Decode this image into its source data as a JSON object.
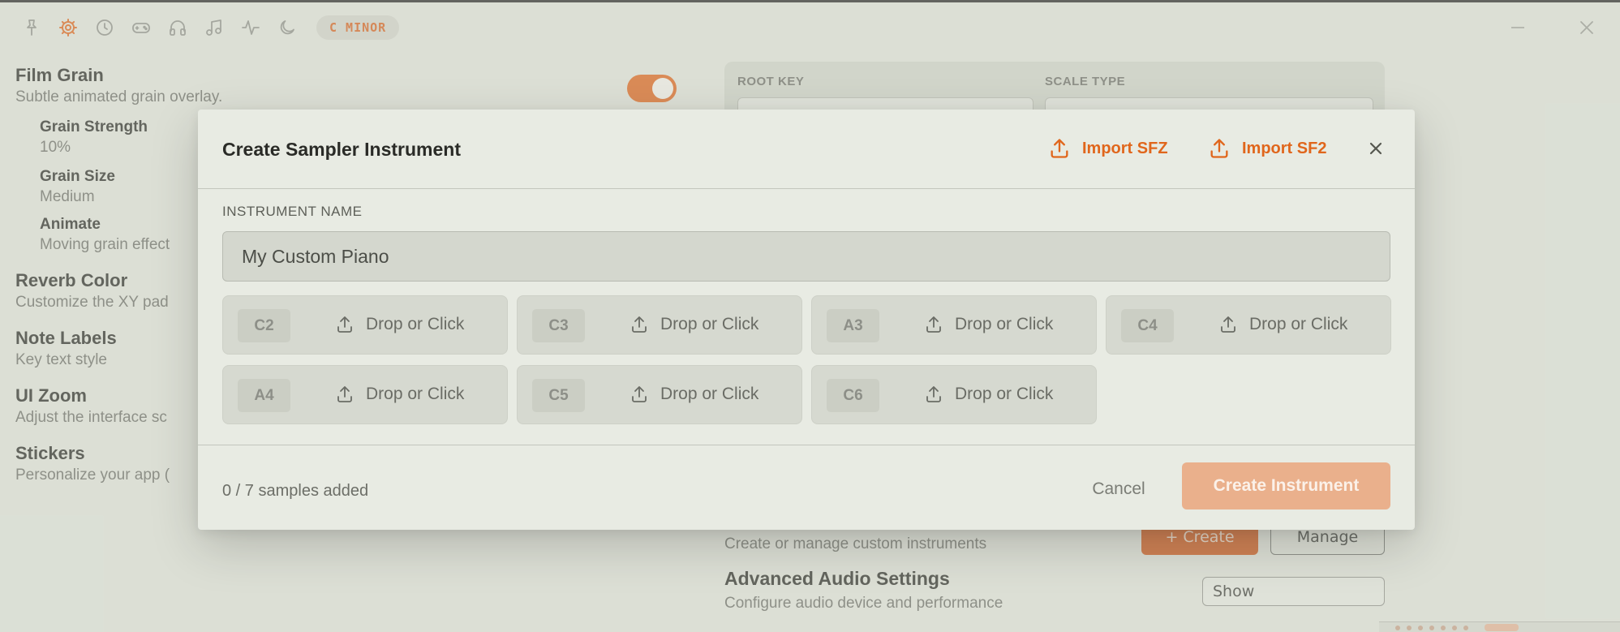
{
  "toolbar": {
    "icons": [
      "pin-icon",
      "gear-icon",
      "clock-icon",
      "gamepad-icon",
      "headphones-icon",
      "music-note-icon",
      "waveform-icon",
      "moon-icon"
    ],
    "active_icon": "gear-icon",
    "key_badge": "C MINOR"
  },
  "window": {
    "minimize_icon": "minimize-icon",
    "close_icon": "close-icon"
  },
  "settings": {
    "film_grain": {
      "title": "Film Grain",
      "subtitle": "Subtle animated grain overlay.",
      "enabled": true
    },
    "grain_strength": {
      "title": "Grain Strength",
      "value": "10%"
    },
    "grain_size": {
      "title": "Grain Size",
      "value": "Medium"
    },
    "animate": {
      "title": "Animate",
      "value": "Moving grain effect"
    },
    "reverb_color": {
      "title": "Reverb Color",
      "subtitle": "Customize the XY pad"
    },
    "note_labels": {
      "title": "Note Labels",
      "subtitle": "Key text style"
    },
    "ui_zoom": {
      "title": "UI Zoom",
      "subtitle": "Adjust the interface sc"
    },
    "stickers": {
      "title": "Stickers",
      "subtitle": "Personalize your app ("
    }
  },
  "right_panel": {
    "root_key_label": "ROOT KEY",
    "scale_type_label": "SCALE TYPE",
    "custom_instruments_subtitle": "Create or manage custom instruments",
    "create_button": "+ Create",
    "manage_button": "Manage",
    "advanced_title": "Advanced Audio Settings",
    "advanced_subtitle": "Configure audio device and performance",
    "show_button": "Show"
  },
  "modal": {
    "title": "Create Sampler Instrument",
    "import_sfz": "Import SFZ",
    "import_sf2": "Import SF2",
    "name_label": "INSTRUMENT NAME",
    "name_value": "My Custom Piano",
    "slots": [
      {
        "note": "C2",
        "label": "Drop or Click"
      },
      {
        "note": "C3",
        "label": "Drop or Click"
      },
      {
        "note": "A3",
        "label": "Drop or Click"
      },
      {
        "note": "C4",
        "label": "Drop or Click"
      },
      {
        "note": "A4",
        "label": "Drop or Click"
      },
      {
        "note": "C5",
        "label": "Drop or Click"
      },
      {
        "note": "C6",
        "label": "Drop or Click"
      }
    ],
    "samples_added": 0,
    "samples_total": 7,
    "count_text": "0 / 7 samples added",
    "cancel": "Cancel",
    "create": "Create Instrument"
  },
  "colors": {
    "accent": "#e0661c",
    "accent_disabled": "#eab08c",
    "background": "#e3e7de",
    "modal_bg": "#e8ebe3"
  }
}
